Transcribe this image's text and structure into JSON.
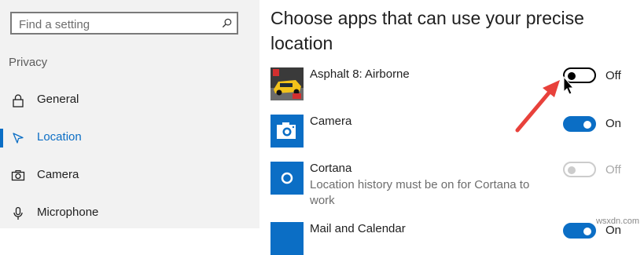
{
  "sidebar": {
    "search_placeholder": "Find a setting",
    "section_label": "Privacy",
    "items": [
      {
        "label": "General",
        "icon": "lock-icon"
      },
      {
        "label": "Location",
        "icon": "location-icon",
        "selected": true
      },
      {
        "label": "Camera",
        "icon": "camera-icon"
      },
      {
        "label": "Microphone",
        "icon": "microphone-icon"
      }
    ]
  },
  "main": {
    "title": "Choose apps that can use your precise location",
    "apps": [
      {
        "name": "Asphalt 8: Airborne",
        "toggle_label": "Off",
        "state": "off"
      },
      {
        "name": "Camera",
        "toggle_label": "On",
        "state": "on"
      },
      {
        "name": "Cortana",
        "subtitle": "Location history must be on for Cortana to work",
        "toggle_label": "Off",
        "state": "disabled"
      },
      {
        "name": "Mail and Calendar",
        "toggle_label": "On",
        "state": "on"
      }
    ]
  },
  "colors": {
    "accent": "#0b6ec5",
    "annotation_arrow": "#e8413b"
  },
  "watermark": "wsxdn.com"
}
